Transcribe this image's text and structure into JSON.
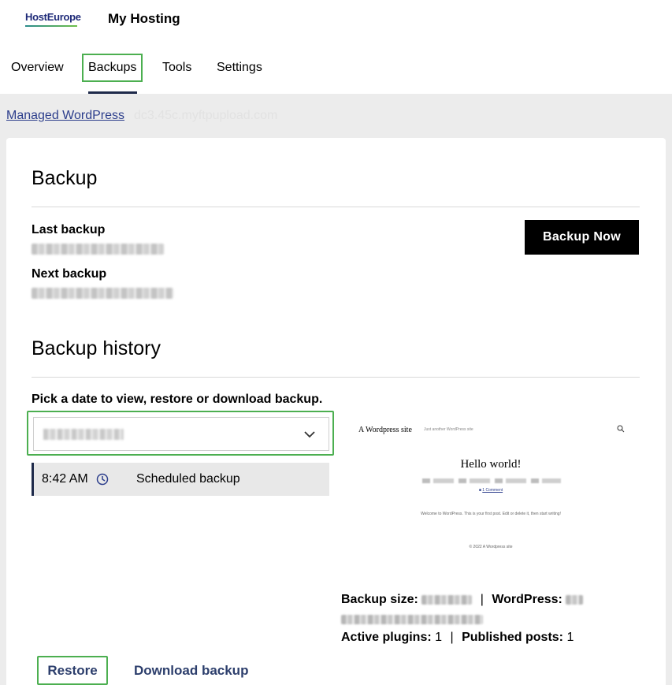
{
  "header": {
    "logo_host": "Host",
    "logo_europe": "Europe",
    "app_title": "My Hosting"
  },
  "tabs": [
    {
      "label": "Overview"
    },
    {
      "label": "Backups"
    },
    {
      "label": "Tools"
    },
    {
      "label": "Settings"
    }
  ],
  "breadcrumb": {
    "link": "Managed WordPress",
    "host": "dc3.45c.myftpupload.com"
  },
  "backup": {
    "title": "Backup",
    "last_label": "Last backup",
    "next_label": "Next backup",
    "button": "Backup Now"
  },
  "history": {
    "title": "Backup history",
    "pick_label": "Pick a date to view, restore or download backup.",
    "slot_time": "8:42 AM",
    "slot_type": "Scheduled backup"
  },
  "preview": {
    "site_name": "A Wordpress site",
    "tagline": "Just another WordPress site",
    "post_title": "Hello world!",
    "comments": "1 Comment",
    "body": "Welcome to WordPress. This is your first post. Edit or delete it, then start writing!",
    "footer": "© 2022 A Wordpress site"
  },
  "stats": {
    "size_label": "Backup size:",
    "wp_label": "WordPress:",
    "plugins_label": "Active plugins:",
    "plugins_value": "1",
    "posts_label": "Published posts:",
    "posts_value": "1",
    "separator": "|"
  },
  "actions": {
    "restore": "Restore",
    "download": "Download backup"
  },
  "colors": {
    "accent_outline": "#4caf50",
    "link": "#2c3e8c",
    "primary_button": "#000000"
  }
}
